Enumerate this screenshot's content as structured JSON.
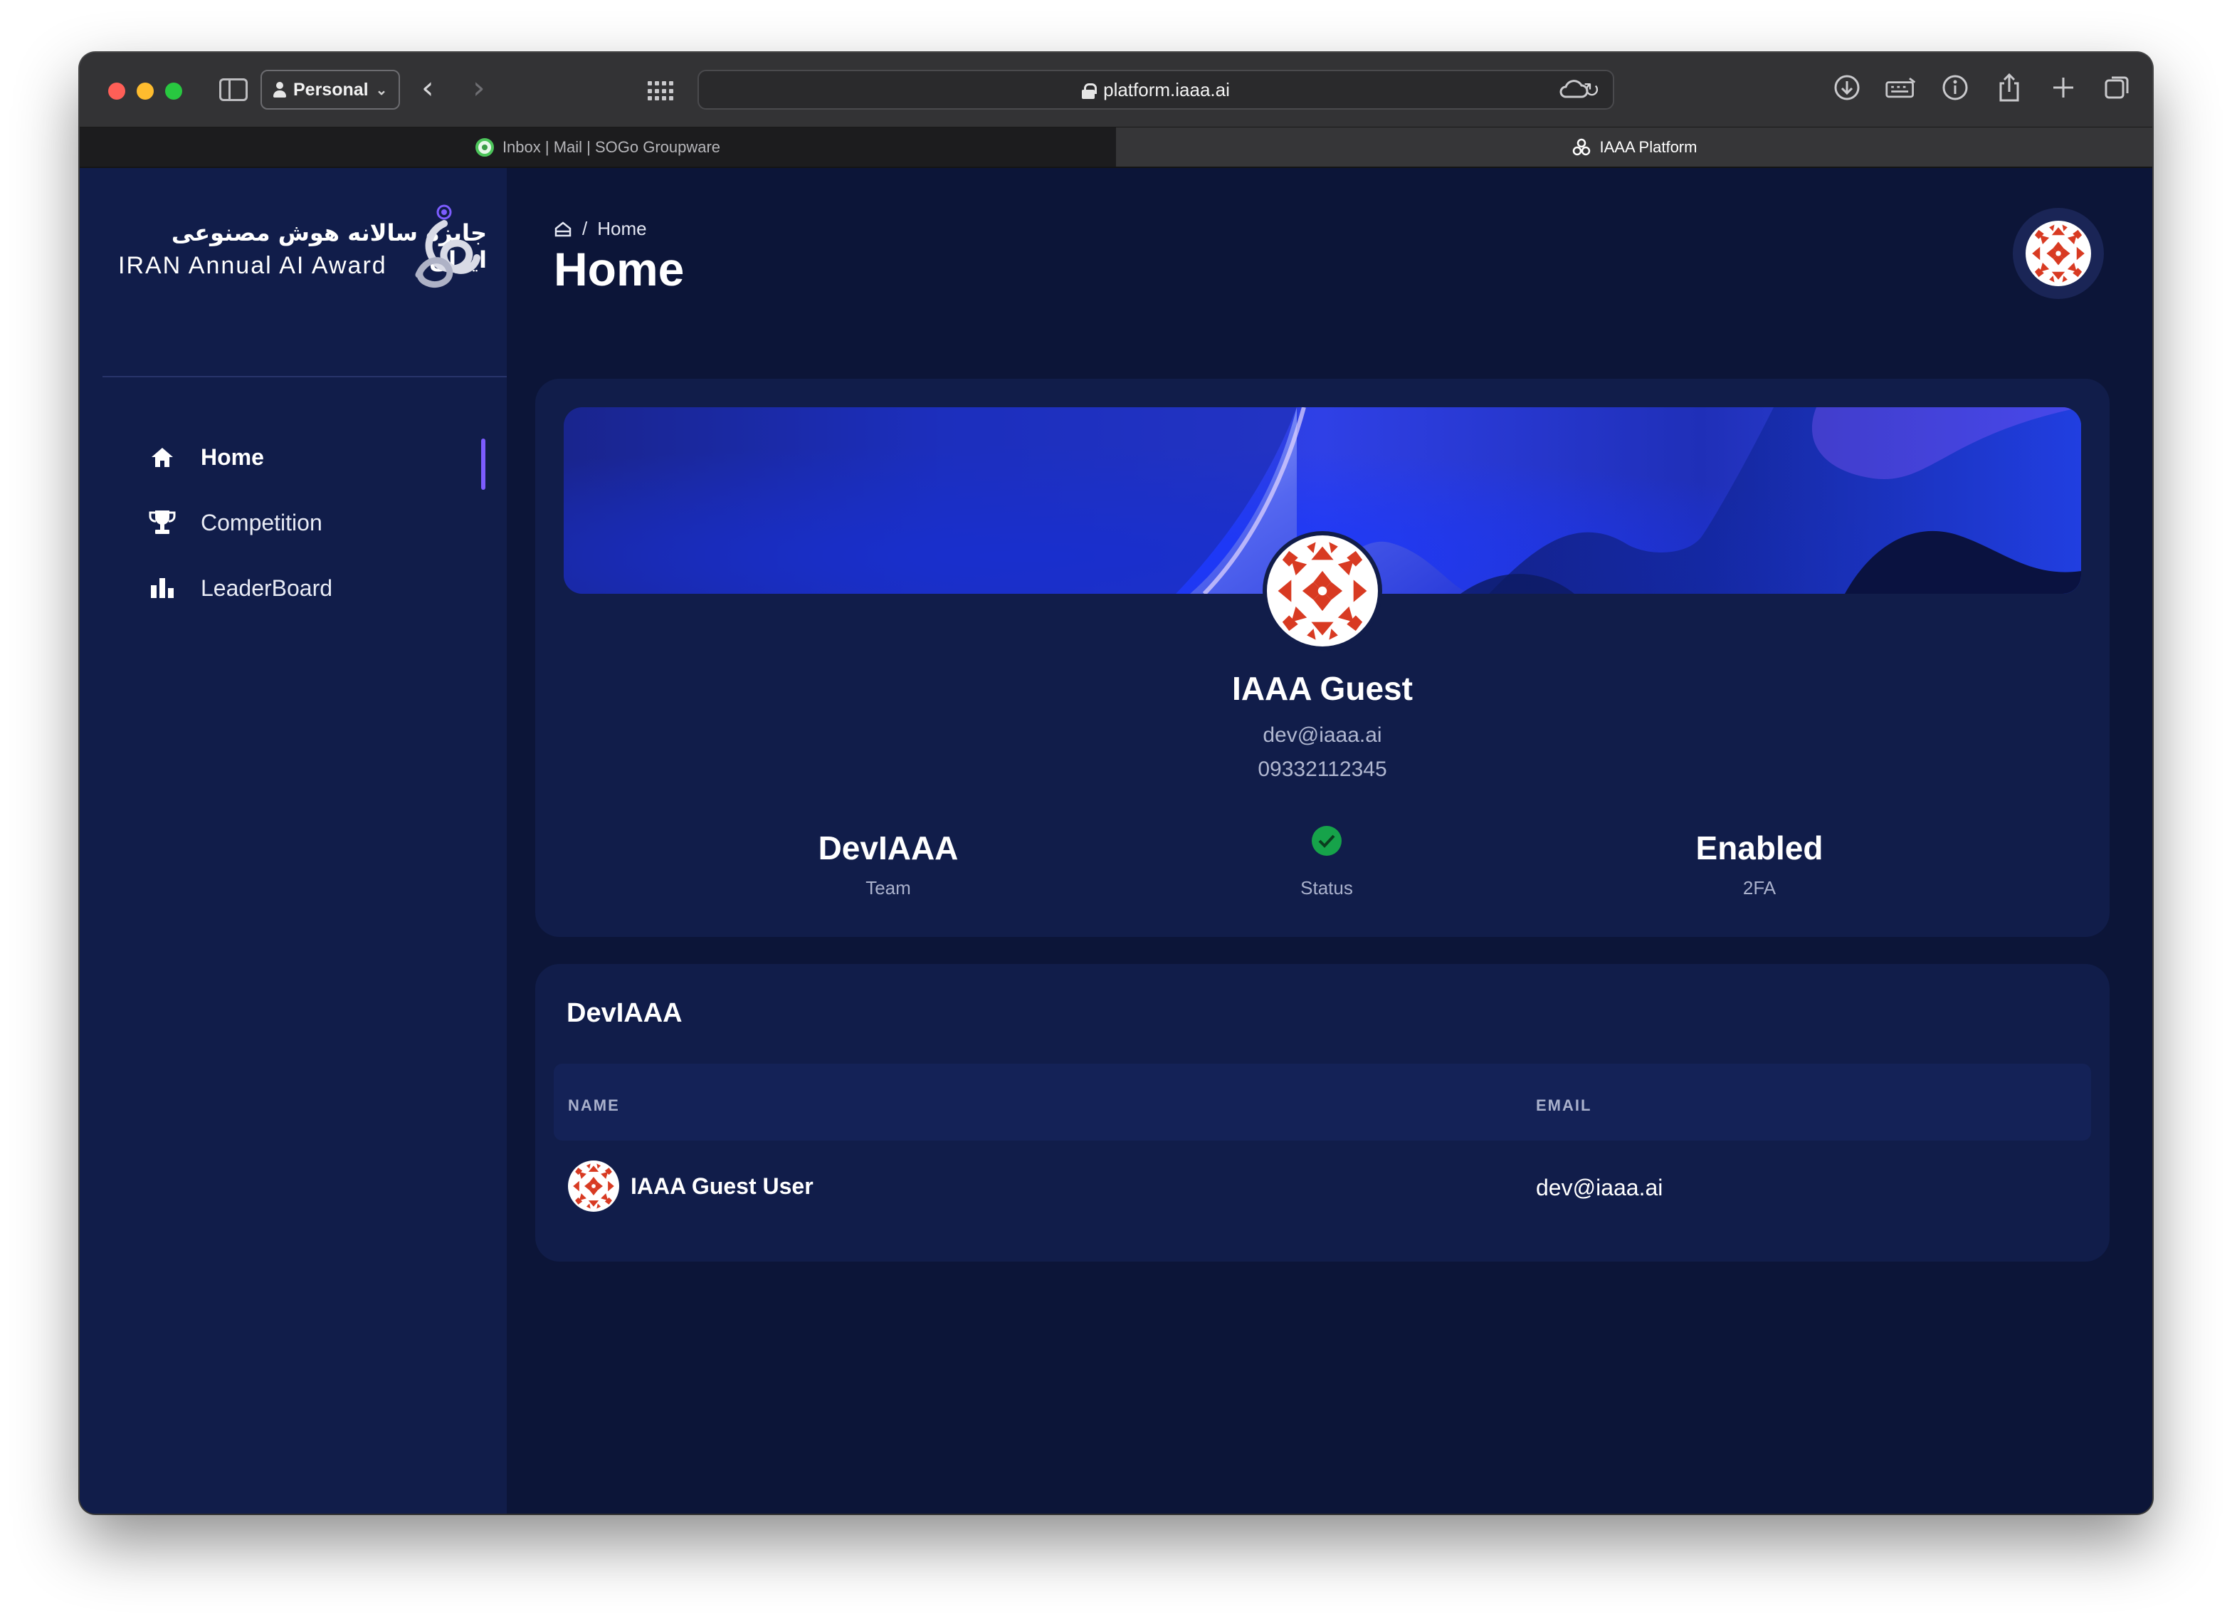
{
  "browser": {
    "profile_label": "Personal",
    "url": "platform.iaaa.ai",
    "tabs": [
      {
        "label": "Inbox | Mail | SOGo Groupware",
        "active": false
      },
      {
        "label": "IAAA Platform",
        "active": true
      }
    ]
  },
  "sidebar": {
    "logo_fa": "جایزه سالانه هوش مصنوعی ایران",
    "logo_en": "IRAN Annual AI Award",
    "items": [
      {
        "label": "Home",
        "icon": "home-icon",
        "active": true
      },
      {
        "label": "Competition",
        "icon": "trophy-icon",
        "active": false
      },
      {
        "label": "LeaderBoard",
        "icon": "bar-chart-icon",
        "active": false
      }
    ]
  },
  "header": {
    "breadcrumb_current": "Home",
    "breadcrumb_separator": "/",
    "title": "Home"
  },
  "profile": {
    "name": "IAAA Guest",
    "email": "dev@iaaa.ai",
    "phone": "09332112345",
    "stats": {
      "team_value": "DevIAAA",
      "team_label": "Team",
      "status_label": "Status",
      "twofa_value": "Enabled",
      "twofa_label": "2FA"
    }
  },
  "team": {
    "title": "DevIAAA",
    "columns": [
      "NAME",
      "EMAIL"
    ],
    "rows": [
      {
        "name": "IAAA Guest User",
        "email": "dev@iaaa.ai"
      }
    ]
  },
  "colors": {
    "app_bg": "#0c1538",
    "card_bg": "#111d4a",
    "accent": "#7c5cff",
    "success": "#16a34a",
    "avatar_red": "#d83a22"
  }
}
